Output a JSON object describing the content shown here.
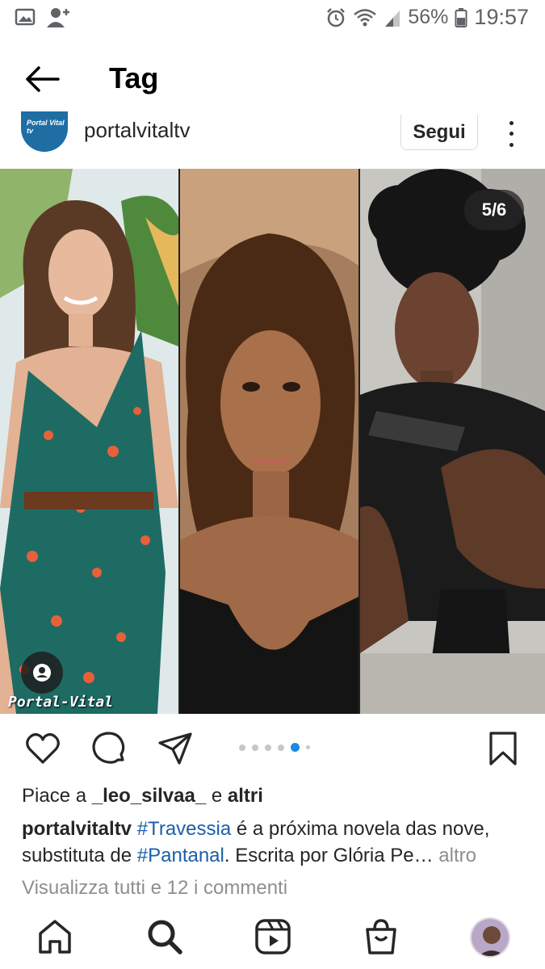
{
  "status_bar": {
    "left_icons": [
      "image-icon",
      "person-add-icon"
    ],
    "right_icons": [
      "alarm-icon",
      "wifi-icon",
      "signal-icon",
      "battery-icon"
    ],
    "battery": "56%",
    "time": "19:57"
  },
  "header": {
    "back_icon": "arrow-left-icon",
    "title": "Tag"
  },
  "post": {
    "avatar_text": "Portal Vital tv",
    "username": "portalvitaltv",
    "follow_label": "Segui",
    "more_icon": "vertical-ellipsis-icon",
    "counter": "5/6",
    "watermark": "Portal-Vital",
    "carousel_current": 5,
    "carousel_total": 6
  },
  "actions": {
    "icons": [
      "heart-icon",
      "comment-icon",
      "share-icon",
      "bookmark-icon"
    ]
  },
  "likes": {
    "prefix": "Piace a",
    "user": "_leo_silvaa_",
    "middle": "e",
    "suffix": "altri"
  },
  "caption": {
    "username": "portalvitaltv",
    "hashtag1": "#Travessia",
    "text1": "é a próxima novela das nove, substituta de",
    "hashtag2": "#Pantanal",
    "text2": ". Escrita por Glória Pe…",
    "more": "altro"
  },
  "comments_link": "Visualizza tutti e 12 i commenti",
  "bottom_nav": [
    "home-icon",
    "search-icon",
    "reels-icon",
    "shop-icon",
    "profile-avatar"
  ],
  "colors": {
    "text": "#262626",
    "muted": "#8e8e8e",
    "hashtag": "#1b5fa8",
    "active_dot": "#1e88e5",
    "avatar_bg": "#1e6ea4"
  }
}
